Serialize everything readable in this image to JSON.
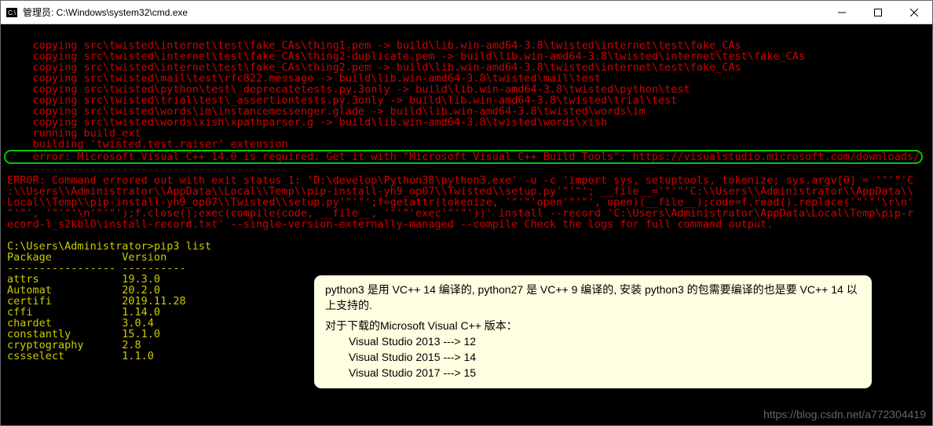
{
  "window": {
    "title": "管理员: C:\\Windows\\system32\\cmd.exe"
  },
  "console": {
    "lines_red": [
      "    copying src\\twisted\\internet\\test\\fake_CAs\\thing1.pem -> build\\lib.win-amd64-3.8\\twisted\\internet\\test\\fake_CAs",
      "    copying src\\twisted\\internet\\test\\fake_CAs\\thing2-duplicate.pem -> build\\lib.win-amd64-3.8\\twisted\\internet\\test\\fake_CAs",
      "    copying src\\twisted\\internet\\test\\fake_CAs\\thing2.pem -> build\\lib.win-amd64-3.8\\twisted\\internet\\test\\fake_CAs",
      "    copying src\\twisted\\mail\\test\\rfc822.message -> build\\lib.win-amd64-3.8\\twisted\\mail\\test",
      "    copying src\\twisted\\python\\test\\_deprecatetests.py.3only -> build\\lib.win-amd64-3.8\\twisted\\python\\test",
      "    copying src\\twisted\\trial\\test\\_assertiontests.py.3only -> build\\lib.win-amd64-3.8\\twisted\\trial\\test",
      "    copying src\\twisted\\words\\im\\instancemessenger.glade -> build\\lib.win-amd64-3.8\\twisted\\words\\im",
      "    copying src\\twisted\\words\\xish\\xpathparser.g -> build\\lib.win-amd64-3.8\\twisted\\words\\xish",
      "    running build_ext",
      "    building 'twisted.test.raiser' extension"
    ],
    "highlight": "    error: Microsoft Visual C++ 14.0 is required. Get it with \"Microsoft Visual C++ Build Tools\": https://visualstudio.microsoft.com/downloads/",
    "blank_line": "    ----------------------------------------",
    "error_block": "ERROR: Command errored out with exit status 1: 'D:\\develop\\Python38\\python3.exe' -u -c 'import sys, setuptools, tokenize; sys.argv[0] = '\"'\"'C\n:\\\\Users\\\\Administrator\\\\AppData\\\\Local\\\\Temp\\\\pip-install-yh9_op07\\\\Twisted\\\\setup.py'\"'\"'; __file__='\"'\"'C:\\\\Users\\\\Administrator\\\\AppData\\\\\nLocal\\\\Temp\\\\pip-install-yh9_op07\\\\Twisted\\\\setup.py'\"'\"';f=getattr(tokenize, '\"'\"'open'\"'\"', open)(__file__);code=f.read().replace('\"'\"'\\r\\n'\n\"'\"', '\"'\"'\\n'\"'\"');f.close();exec(compile(code, __file__, '\"'\"'exec'\"'\"'))' install --record 'C:\\Users\\Administrator\\AppData\\Local\\Temp\\pip-r\necord-l_s2kbl0\\install-record.txt' --single-version-externally-managed --compile Check the logs for full command output.",
    "prompt": "C:\\Users\\Administrator>",
    "command": "pip3 list",
    "table_header": "Package           Version",
    "table_sep": "----------------- ----------",
    "packages": [
      [
        "attrs",
        "19.3.0"
      ],
      [
        "Automat",
        "20.2.0"
      ],
      [
        "certifi",
        "2019.11.28"
      ],
      [
        "cffi",
        "1.14.0"
      ],
      [
        "chardet",
        "3.0.4"
      ],
      [
        "constantly",
        "15.1.0"
      ],
      [
        "cryptography",
        "2.8"
      ],
      [
        "cssselect",
        "1.1.0"
      ]
    ]
  },
  "tooltip": {
    "line1": "python3 是用 VC++ 14 编译的, python27 是 VC++ 9 编译的, 安装 python3 的包需要编译的也是要 VC++ 14 以上支持的.",
    "line2": "对于下载的Microsoft Visual C++ 版本：",
    "m1": "Visual Studio 2013 ---> 12",
    "m2": "Visual Studio 2015 ---> 14",
    "m3": "Visual Studio 2017 ---> 15"
  },
  "watermark": "https://blog.csdn.net/a772304419"
}
